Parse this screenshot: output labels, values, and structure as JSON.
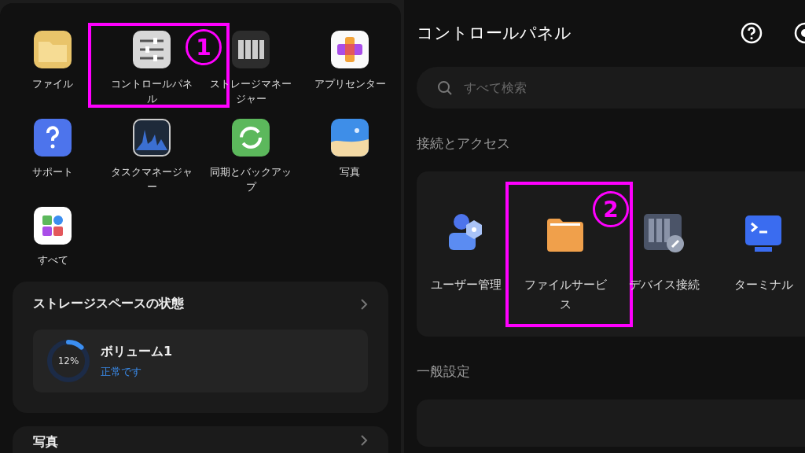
{
  "apps": [
    {
      "label": "ファイル"
    },
    {
      "label": "コントロールパネル",
      "annotation": "1"
    },
    {
      "label": "ストレージマネージャー"
    },
    {
      "label": "アプリセンター"
    },
    {
      "label": "サポート"
    },
    {
      "label": "タスクマネージャー"
    },
    {
      "label": "同期とバックアップ"
    },
    {
      "label": "写真"
    },
    {
      "label": "すべて"
    }
  ],
  "storage": {
    "title": "ストレージスペースの状態",
    "volume": {
      "name": "ボリューム1",
      "status": "正常です",
      "percent": "12%",
      "level": 0.12
    }
  },
  "next_card": {
    "title": "写真"
  },
  "control_panel": {
    "title": "コントロールパネル",
    "search": {
      "placeholder": "すべて検索"
    },
    "sections": [
      {
        "title": "接続とアクセス",
        "items": [
          {
            "label": "ユーザー管理"
          },
          {
            "label": "ファイルサービス",
            "annotation": "2"
          },
          {
            "label": "デバイス接続"
          },
          {
            "label": "ターミナル"
          }
        ]
      },
      {
        "title": "一般設定"
      }
    ]
  }
}
